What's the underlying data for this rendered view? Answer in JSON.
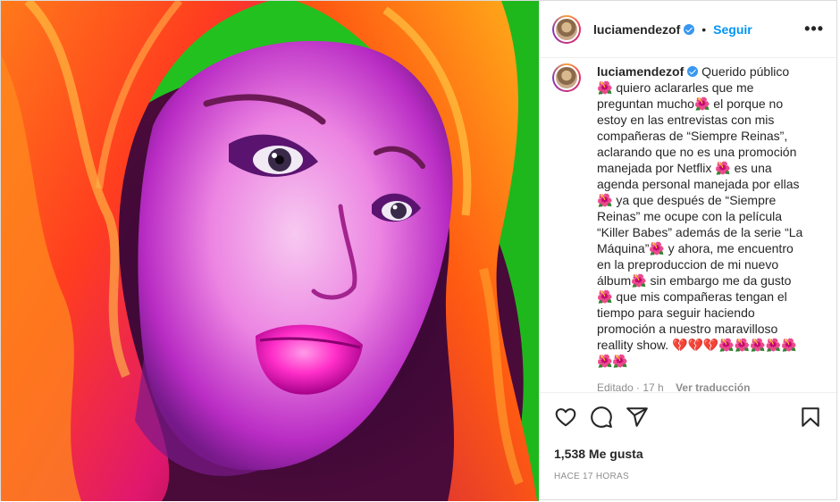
{
  "post": {
    "username": "luciamendezof",
    "follow_label": "Seguir",
    "separator": "•",
    "more_label": "•••",
    "caption": "Querido público 🌺 quiero aclararles que me preguntan mucho🌺 el porque no estoy en las entrevistas con mis compañeras de “Siempre Reinas”, aclarando que no es una promoción manejada por Netflix 🌺 es una agenda personal manejada por ellas 🌺 ya que después de “Siempre Reinas” me ocupe con la película “Killer Babes” además de la serie “La Máquina”🌺 y ahora, me encuentro en la preproduccion de mi nuevo álbum🌺 sin embargo me da gusto🌺 que mis compañeras tengan el tiempo para seguir haciendo promoción a nuestro maravilloso reallity show. 💔💔💔🌺🌺🌺🌺🌺🌺🌺",
    "edited_label": "Editado",
    "edited_time": "17 h",
    "translate_label": "Ver traducción",
    "likes": "1,538 Me gusta",
    "posted_time": "HACE 17 HORAS"
  },
  "icons": {
    "like": "heart-icon",
    "comment": "comment-icon",
    "share": "share-icon",
    "save": "bookmark-icon",
    "verified": "verified-badge-icon"
  },
  "colors": {
    "follow": "#0095f6",
    "verified": "#3897f0",
    "artwork_background": "#22c11f"
  }
}
